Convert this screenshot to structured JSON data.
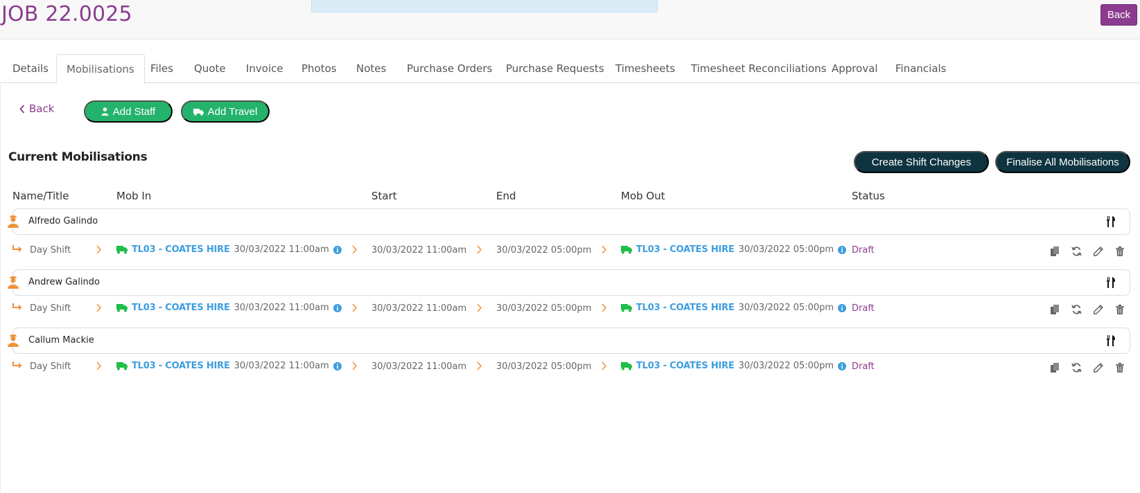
{
  "header": {
    "job_title": "JOB 22.0025",
    "back_label": "Back"
  },
  "tabs": [
    {
      "label": "Details"
    },
    {
      "label": "Mobilisations",
      "active": true
    },
    {
      "label": "Files"
    },
    {
      "label": "Quote"
    },
    {
      "label": "Invoice"
    },
    {
      "label": "Photos"
    },
    {
      "label": "Notes"
    },
    {
      "label": "Purchase Orders"
    },
    {
      "label": "Purchase Requests"
    },
    {
      "label": "Timesheets"
    },
    {
      "label": "Timesheet Reconciliations"
    },
    {
      "label": "Approval"
    },
    {
      "label": "Financials"
    }
  ],
  "toolbar": {
    "back_label": "Back",
    "add_staff_label": "Add Staff",
    "add_travel_label": "Add Travel"
  },
  "section": {
    "title": "Current Mobilisations",
    "create_shift_changes_label": "Create Shift Changes",
    "finalise_all_label": "Finalise All Mobilisations"
  },
  "columns": {
    "name": "Name/Title",
    "mob_in": "Mob In",
    "start": "Start",
    "end": "End",
    "mob_out": "Mob Out",
    "status": "Status"
  },
  "mobilisations": [
    {
      "name": "Alfredo Galindo",
      "shift": "Day Shift",
      "mob_in_vehicle": "TL03 - COATES HIRE",
      "mob_in_datetime": "30/03/2022 11:00am",
      "start": "30/03/2022 11:00am",
      "end": "30/03/2022 05:00pm",
      "mob_out_vehicle": "TL03 - COATES HIRE",
      "mob_out_datetime": "30/03/2022 05:00pm",
      "status": "Draft"
    },
    {
      "name": "Andrew Galindo",
      "shift": "Day Shift",
      "mob_in_vehicle": "TL03 - COATES HIRE",
      "mob_in_datetime": "30/03/2022 11:00am",
      "start": "30/03/2022 11:00am",
      "end": "30/03/2022 05:00pm",
      "mob_out_vehicle": "TL03 - COATES HIRE",
      "mob_out_datetime": "30/03/2022 05:00pm",
      "status": "Draft"
    },
    {
      "name": "Callum Mackie",
      "shift": "Day Shift",
      "mob_in_vehicle": "TL03 - COATES HIRE",
      "mob_in_datetime": "30/03/2022 11:00am",
      "start": "30/03/2022 11:00am",
      "end": "30/03/2022 05:00pm",
      "mob_out_vehicle": "TL03 - COATES HIRE",
      "mob_out_datetime": "30/03/2022 05:00pm",
      "status": "Draft"
    }
  ],
  "icons": {
    "person": "person-icon",
    "cutlery": "cutlery-icon",
    "shift_arrow": "arrow-right-turn-icon",
    "chevron": "chevron-right-icon",
    "truck": "truck-icon",
    "info": "info-icon",
    "copy": "copy-icon",
    "refresh": "refresh-icon",
    "edit": "pencil-icon",
    "delete": "trash-icon"
  },
  "colors": {
    "brand_purple": "#8b3c8f",
    "green": "#24b36b",
    "dark_teal": "#0e3440",
    "link_blue": "#3d9ee0",
    "orange": "#f0913a",
    "truck_green": "#1fbf4a"
  }
}
